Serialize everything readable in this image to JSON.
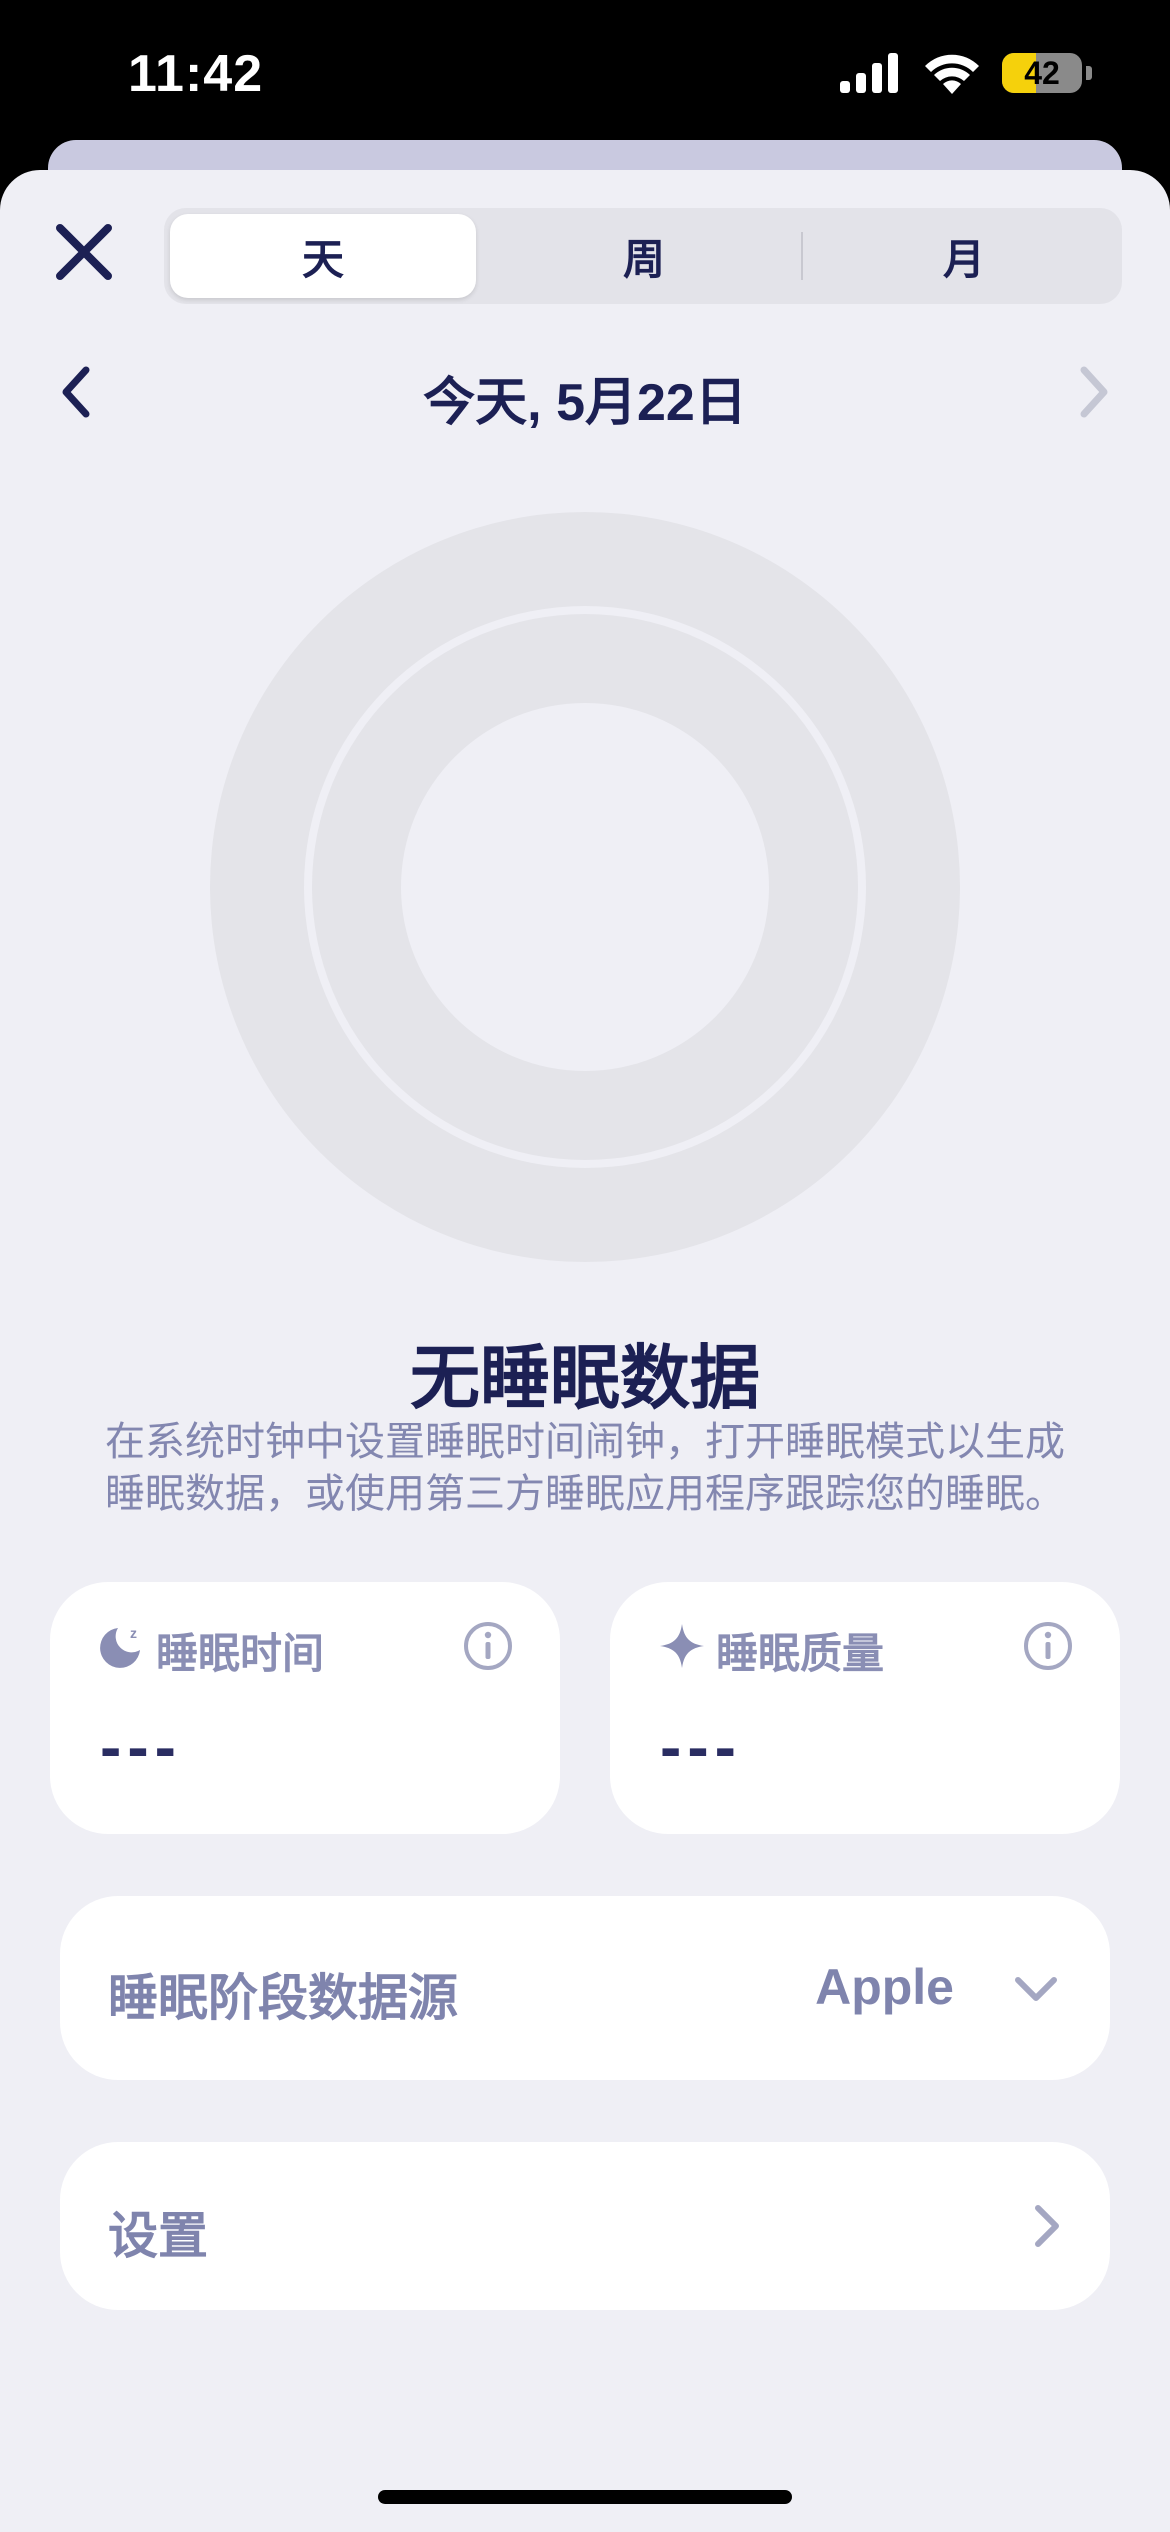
{
  "status_bar": {
    "time": "11:42",
    "battery_level": "42",
    "icons": [
      "cellular-signal-icon",
      "wifi-icon",
      "battery-icon"
    ]
  },
  "segments": {
    "items": [
      {
        "label": "天",
        "selected": true
      },
      {
        "label": "周",
        "selected": false
      },
      {
        "label": "月",
        "selected": false
      }
    ]
  },
  "date_nav": {
    "title": "今天, 5月22日"
  },
  "empty_state": {
    "title": "无睡眠数据",
    "description_line1": "在系统时钟中设置睡眠时间闹钟，打开睡眠模式以生成",
    "description_line2": "睡眠数据，或使用第三方睡眠应用程序跟踪您的睡眠。"
  },
  "metrics": {
    "sleep_time": {
      "label": "睡眠时间",
      "value": "---"
    },
    "sleep_quality": {
      "label": "睡眠质量",
      "value": "---"
    }
  },
  "data_source": {
    "label": "睡眠阶段数据源",
    "value": "Apple"
  },
  "settings": {
    "label": "设置"
  },
  "colors": {
    "accent_navy": "#1c2054",
    "muted_text": "#8387b0",
    "sheet_background": "#efeff5",
    "ring_gray": "#e4e4e9",
    "battery_yellow": "#f5d10c"
  }
}
